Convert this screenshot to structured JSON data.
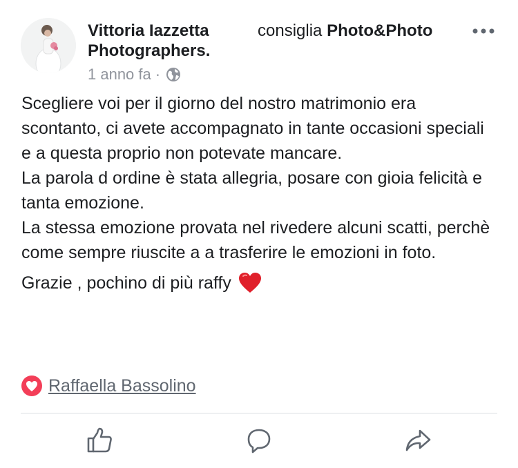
{
  "post": {
    "author": "Vittoria Iazzetta",
    "recommends_verb": "consiglia",
    "page_name": "Photo&Photo",
    "page_name_cont": "Photographers",
    "timestamp": "1 anno fa",
    "separator": "·",
    "privacy_icon": "globe-icon",
    "body_lines": [
      "Scegliere voi per il giorno del nostro matrimonio era scontanto, ci avete accompagnato in tante occasioni speciali e a questa proprio non potevate mancare.",
      "La parola d ordine è stata allegria, posare con gioia felicità e tanta emozione.",
      "La stessa emozione provata nel rivedere alcuni scatti, perchè come sempre riuscite a a trasferire le emozioni in foto."
    ],
    "thanks_line": "Grazie , pochino di più raffy",
    "thanks_emoji": "red-heart-emoji"
  },
  "reactions": {
    "type": "love",
    "reactor_name": "Raffaella Bassolino"
  },
  "actions": {
    "like_icon": "thumbs-up-icon",
    "comment_icon": "comment-icon",
    "share_icon": "share-icon"
  },
  "colors": {
    "text": "#1c1e21",
    "meta": "#90949c",
    "love": "#f33e58",
    "divider": "#dadde1",
    "action_icon": "#606770"
  }
}
